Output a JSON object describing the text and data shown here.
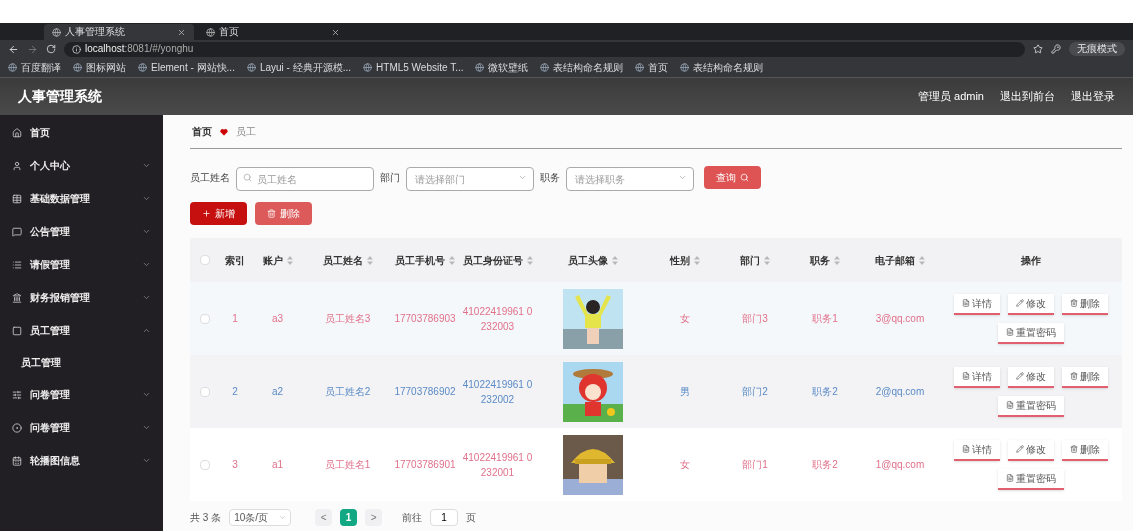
{
  "browser": {
    "tabs": [
      {
        "label": "人事管理系统",
        "selected": true
      },
      {
        "label": "首页",
        "selected": false
      }
    ],
    "url_host": "localhost",
    "url_path": ":8081/#/yonghu",
    "bookmarks": [
      "百度翻译",
      "图标网站",
      "Element - 网站快...",
      "Layui - 经典开源模...",
      "HTML5 Website T...",
      "微软壁纸",
      "表结构命名规则",
      "首页",
      "表结构命名规则"
    ],
    "profile": "无痕模式"
  },
  "header": {
    "title": "人事管理系统",
    "links": [
      "管理员 admin",
      "退出到前台",
      "退出登录"
    ]
  },
  "sidebar": {
    "items": [
      {
        "label": "首页"
      },
      {
        "label": "个人中心",
        "expanded": false
      },
      {
        "label": "基础数据管理",
        "expanded": false
      },
      {
        "label": "公告管理",
        "expanded": false
      },
      {
        "label": "请假管理",
        "expanded": false
      },
      {
        "label": "财务报销管理",
        "expanded": false
      },
      {
        "label": "员工管理",
        "expanded": true,
        "children": [
          {
            "label": "员工管理"
          }
        ]
      },
      {
        "label": "问卷管理",
        "expanded": false
      },
      {
        "label": "问卷管理",
        "expanded": false
      },
      {
        "label": "轮播图信息",
        "expanded": false
      }
    ]
  },
  "breadcrumb": [
    "首页",
    "员工"
  ],
  "filters": [
    {
      "label": "员工姓名",
      "kind": "text",
      "placeholder": "员工姓名"
    },
    {
      "label": "部门",
      "kind": "select",
      "placeholder": "请选择部门"
    },
    {
      "label": "职务",
      "kind": "select",
      "placeholder": "请选择职务"
    }
  ],
  "search_button": "查询",
  "buttons": [
    {
      "label": "新增",
      "kind": "add"
    },
    {
      "label": "删除",
      "kind": "delete"
    }
  ],
  "table": {
    "select_all": {
      "checked": false
    },
    "columns": [
      {
        "label": "索引",
        "sortable": false
      },
      {
        "label": "账户",
        "sortable": true
      },
      {
        "label": "员工姓名",
        "sortable": true
      },
      {
        "label": "员工手机号",
        "sortable": true
      },
      {
        "label": "员工身份证号",
        "sortable": true
      },
      {
        "label": "员工头像",
        "sortable": true
      },
      {
        "label": "性别",
        "sortable": true
      },
      {
        "label": "部门",
        "sortable": true
      },
      {
        "label": "职务",
        "sortable": true
      },
      {
        "label": "电子邮箱",
        "sortable": true
      },
      {
        "label": "操作",
        "sortable": false
      }
    ],
    "rows": [
      {
        "color": "#e0708a",
        "checked": false,
        "cells": [
          "1",
          "a3",
          "员工姓名3",
          "17703786903",
          "41022419961 0232003"
        ],
        "avatar": {
          "kind": "picture"
        },
        "cells2": [
          "女",
          "部门3",
          "职务1",
          "3@qq.com"
        ],
        "actions": [
          "详情",
          "修改",
          "删除",
          "重置密码"
        ]
      },
      {
        "color": "#5a8ac6",
        "checked": false,
        "cells": [
          "2",
          "a2",
          "员工姓名2",
          "17703786902",
          "41022419961 0232002"
        ],
        "avatar": {
          "kind": "picture"
        },
        "cells2": [
          "男",
          "部门2",
          "职务2",
          "2@qq.com"
        ],
        "actions": [
          "详情",
          "修改",
          "删除",
          "重置密码"
        ]
      },
      {
        "color": "#e0708a",
        "checked": false,
        "cells": [
          "3",
          "a1",
          "员工姓名1",
          "17703786901",
          "41022419961 0232001"
        ],
        "avatar": {
          "kind": "picture"
        },
        "cells2": [
          "女",
          "部门1",
          "职务2",
          "1@qq.com"
        ],
        "actions": [
          "详情",
          "修改",
          "删除",
          "重置密码"
        ]
      }
    ]
  },
  "pagination": {
    "total": "共 3 条",
    "page_size": "10条/页",
    "prev": "<",
    "pages": [
      {
        "label": "1",
        "selected": true
      }
    ],
    "next": ">",
    "goto_label": "前往",
    "goto_value": "1",
    "goto_suffix": "页"
  }
}
